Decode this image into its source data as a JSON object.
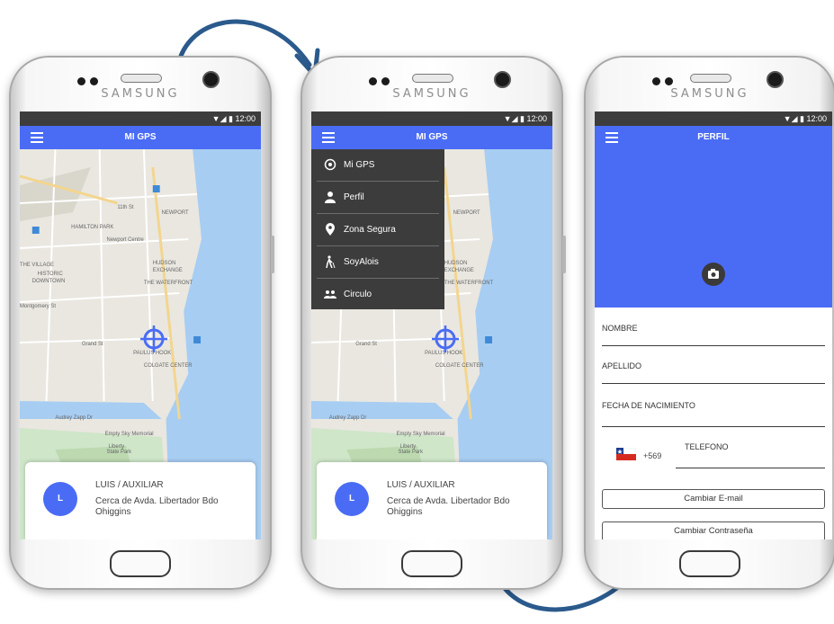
{
  "phones": [
    {
      "brand": "SAMSUNG",
      "status_time": "12:00",
      "title": "MI GPS",
      "card": {
        "initial": "L",
        "name": "LUIS / AUXILIAR",
        "location": "Cerca de Avda. Libertador Bdo Ohiggins"
      }
    },
    {
      "brand": "SAMSUNG",
      "status_time": "12:00",
      "title": "MI GPS",
      "menu": [
        {
          "label": "Mi GPS",
          "icon": "target-icon"
        },
        {
          "label": "Perfil",
          "icon": "person-icon"
        },
        {
          "label": "Zona Segura",
          "icon": "location-pin-icon"
        },
        {
          "label": "SoyAlois",
          "icon": "walking-cane-icon"
        },
        {
          "label": "Circulo",
          "icon": "group-icon"
        }
      ],
      "card": {
        "initial": "L",
        "name": "LUIS / AUXILIAR",
        "location": "Cerca de Avda. Libertador Bdo Ohiggins"
      }
    },
    {
      "brand": "SAMSUNG",
      "status_time": "12:00",
      "title": "PERFIL",
      "fields": {
        "nombre": "NOMBRE",
        "apellido": "APELLIDO",
        "fecha": "FECHA DE NACIMIENTO",
        "telefono": "TELEFONO",
        "phone_prefix": "+569"
      },
      "buttons": {
        "email": "Cambiar E-mail",
        "password": "Cambiar Contraseña"
      }
    }
  ],
  "map_labels": [
    "11th St",
    "HAMILTON PARK",
    "Newport Centre",
    "NEWPORT",
    "THE VILLAGE",
    "HISTORIC DOWNTOWN",
    "HUDSON EXCHANGE",
    "THE WATERFRONT",
    "Montgomery St",
    "Grand St",
    "PAULUS HOOK",
    "COLGATE CENTER",
    "Empty Sky Memorial",
    "Liberty State Park",
    "Audrey Zapp Dr"
  ],
  "colors": {
    "primary": "#4a6cf5",
    "menu_bg": "#3c3c3c",
    "arrow": "#2b5a8c"
  }
}
